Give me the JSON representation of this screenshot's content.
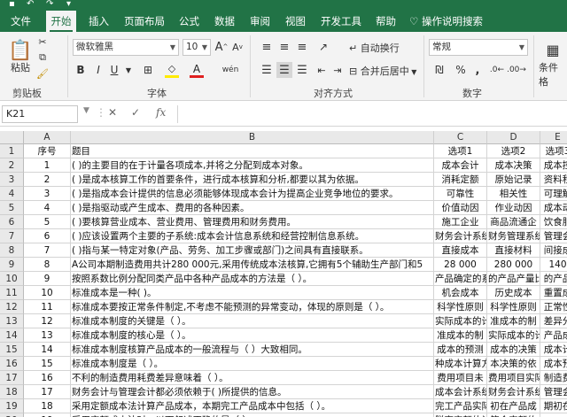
{
  "ribbon_tabs": [
    "文件",
    "开始",
    "插入",
    "页面布局",
    "公式",
    "数据",
    "审阅",
    "视图",
    "开发工具",
    "帮助"
  ],
  "tell_me": "操作说明搜索",
  "clipboard": {
    "paste": "粘贴",
    "label": "剪贴板"
  },
  "font": {
    "name": "微软雅黑",
    "size": "10",
    "label": "字体",
    "increase": "A",
    "decrease": "A",
    "bold": "B",
    "italic": "I",
    "underline": "U",
    "wen": "wén"
  },
  "alignment": {
    "wrap": "自动换行",
    "merge": "合并后居中",
    "label": "对齐方式"
  },
  "number": {
    "format": "常规",
    "label": "数字",
    "percent": "%",
    "comma": ","
  },
  "styles": {
    "cond": "条件格"
  },
  "formula_bar": {
    "cell_ref": "K21",
    "fx": "fx",
    "value": ""
  },
  "columns": [
    "A",
    "B",
    "C",
    "D",
    "E"
  ],
  "rows": [
    {
      "n": "1",
      "a": "序号",
      "b": "题目",
      "c": "选项1",
      "d": "选项2",
      "e": "选项3"
    },
    {
      "n": "2",
      "a": "1",
      "b": "(      )的主要目的在于计量各项成本,并将之分配到成本对象。",
      "c": "成本会计",
      "d": "成本决策",
      "e": "成本控"
    },
    {
      "n": "3",
      "a": "2",
      "b": "(      )是成本核算工作的首要条件，进行成本核算和分析,都要以其为依据。",
      "c": "消耗定额",
      "d": "原始记录",
      "e": "资料积"
    },
    {
      "n": "4",
      "a": "3",
      "b": "(      )是指成本会计提供的信息必须能够体现成本会计为提高企业竞争地位的要求。",
      "c": "可靠性",
      "d": "相关性",
      "e": "可理解"
    },
    {
      "n": "5",
      "a": "4",
      "b": "(      )是指驱动或产生成本、费用的各种因素。",
      "c": "价值动因",
      "d": "作业动因",
      "e": "成本动"
    },
    {
      "n": "6",
      "a": "5",
      "b": "(      )要核算营业成本、营业费用、管理费用和财务费用。",
      "c": "施工企业",
      "d": "商品流通企",
      "e": "饮食服"
    },
    {
      "n": "7",
      "a": "6",
      "b": "(      )应该设置两个主要的子系统:成本会计信息系统和经营控制信息系统。",
      "c": "财务会计系统",
      "d": "财务管理系统",
      "e": "管理会"
    },
    {
      "n": "8",
      "a": "7",
      "b": "(      )指与某一特定对象(产品、劳务、加工步骤或部门)之间具有直接联系。",
      "c": "直接成本",
      "d": "直接材料",
      "e": "间接成"
    },
    {
      "n": "9",
      "a": "8",
      "b": "A公司本期制造费用共计280 000元,采用传统成本法核算,它拥有5个辅助生产部门和5",
      "c": "28 000",
      "d": "280 000",
      "e": "140"
    },
    {
      "n": "10",
      "a": "9",
      "b": "按照系数比例分配同类产品中各种产品成本的方法是（   ）。",
      "c": "产品确定的系数",
      "d": "的产品产量比",
      "e": "的产品"
    },
    {
      "n": "11",
      "a": "10",
      "b": "标准成本是一种(       )。",
      "c": "机会成本",
      "d": "历史成本",
      "e": "重置成"
    },
    {
      "n": "12",
      "a": "11",
      "b": "标准成本要按正常条件制定,不考虑不能预测的异常变动，体现的原则是（   ）。",
      "c": "科学性原则",
      "d": "科学性原则",
      "e": "正常性"
    },
    {
      "n": "13",
      "a": "12",
      "b": "标准成本制度的关键是（   ）。",
      "c": "实际成本的计",
      "d": "准成本的制",
      "e": "差异分"
    },
    {
      "n": "14",
      "a": "13",
      "b": "标准成本制度的核心是（   ）。",
      "c": "准成本的制",
      "d": "实际成本的计",
      "e": "产品成"
    },
    {
      "n": "15",
      "a": "14",
      "b": "标准成本制度核算产品成本的一般流程与（   ）大致相同。",
      "c": "成本的预测",
      "d": "成本的决策",
      "e": "成本计"
    },
    {
      "n": "16",
      "a": "15",
      "b": "标准成本制度是（   ）。",
      "c": "种成本计算方",
      "d": "本决策的依",
      "e": "成本预"
    },
    {
      "n": "17",
      "a": "16",
      "b": "不利的制造费用耗费差异意味着（   ）。",
      "c": "费用项目未",
      "d": "费用项目实际",
      "e": "制造费"
    },
    {
      "n": "18",
      "a": "17",
      "b": "财务会计与管理会计都必须依赖于(       )所提供的信息。",
      "c": "成本会计系统",
      "d": "财务会计系统",
      "e": "管理会"
    },
    {
      "n": "19",
      "a": "18",
      "b": "采用定额成本法计算产品成本，本期完工产品成本中包括（   ）。",
      "c": "完工产品实际",
      "d": "初在产品成",
      "e": "期初在"
    },
    {
      "n": "20",
      "a": "19",
      "b": "采用定额成本法时，以下叙述正确的是（   ）。",
      "c": "脱离定额的计",
      "d": "符合定额的",
      "e": ""
    }
  ]
}
